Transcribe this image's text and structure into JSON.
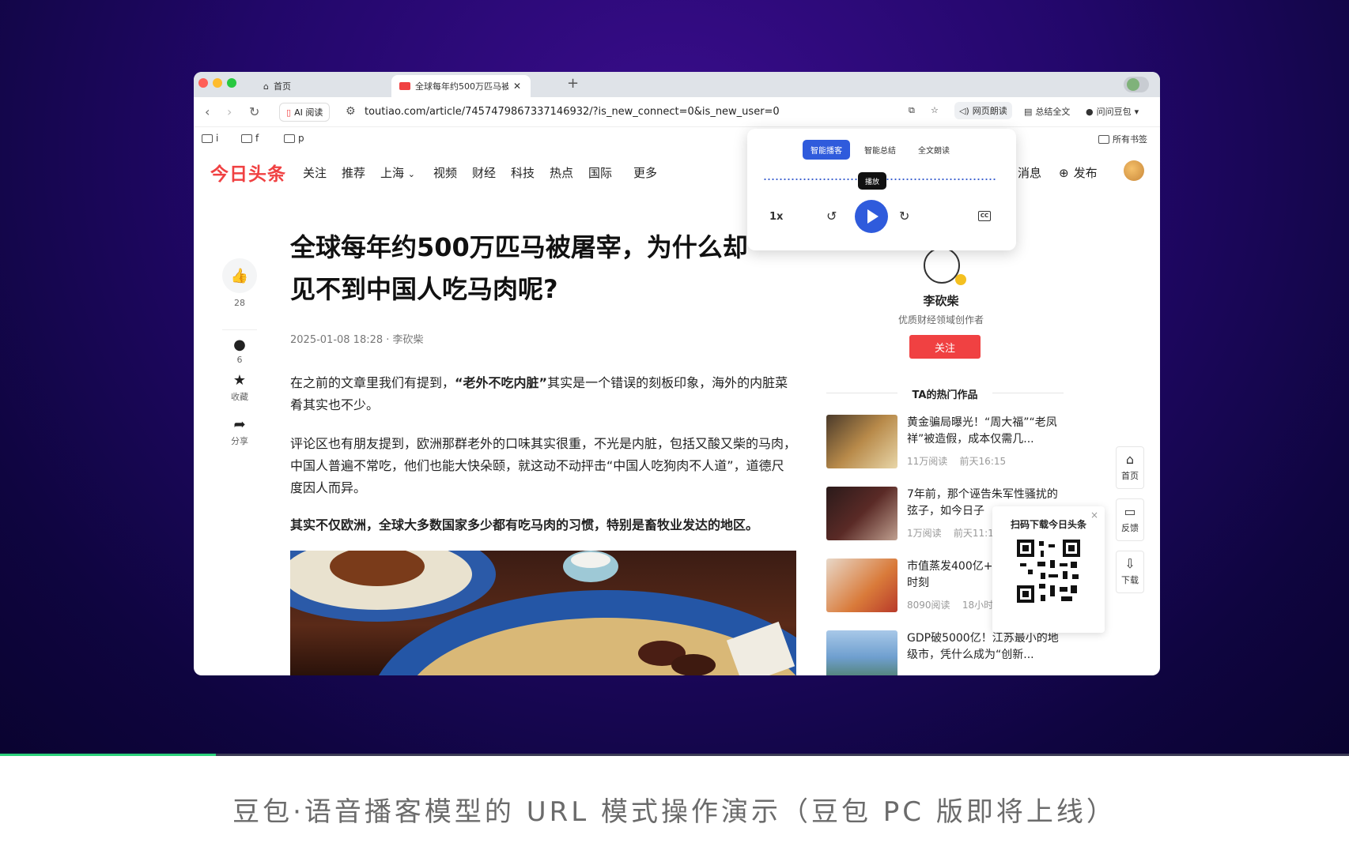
{
  "caption": "豆包·语音播客模型的 URL 模式操作演示（豆包 PC 版即将上线）",
  "video_progress": 0.16,
  "colors": {
    "brand_red": "#f04142",
    "accent_blue": "#2f5bdc",
    "bg_purple": "#22076a"
  },
  "browser": {
    "tabs": [
      {
        "label": "首页",
        "icon": "home-icon"
      },
      {
        "label": "全球每年约500万匹马被",
        "icon": "toutiao-favicon"
      }
    ],
    "new_tab": "+",
    "ai_read": "AI 阅读",
    "url": "toutiao.com/article/7457479867337146932/?is_new_connect=0&is_new_user=0",
    "tools": {
      "read_aloud": "网页朗读",
      "summarize": "总结全文",
      "ask": "问问豆包"
    },
    "bookmarks": [
      "i",
      "f",
      "p"
    ],
    "all_bookmarks": "所有书签"
  },
  "site": {
    "logo": "今日头条",
    "nav": [
      "关注",
      "推荐",
      "上海",
      "视频",
      "财经",
      "科技",
      "热点",
      "国际",
      "更多"
    ],
    "messages": "消息",
    "publish": "发布"
  },
  "rail": {
    "likes": "28",
    "comments": "6",
    "favorite": "收藏",
    "share": "分享"
  },
  "article": {
    "title": "全球每年约500万匹马被屠宰，为什么却见不到中国人吃马肉呢?",
    "meta": "2025-01-08 18:28 · 李砍柴",
    "p1_pre": "在之前的文章里我们有提到，",
    "p1_bold": "“老外不吃内脏”",
    "p1_post": "其实是一个错误的刻板印象，海外的内脏菜肴其实也不少。",
    "p2": "评论区也有朋友提到，欧洲那群老外的口味其实很重，不光是内脏，包括又酸又柴的马肉，中国人普遍不常吃，他们也能大快朵颐，就这动不动抨击“中国人吃狗肉不人道”，道德尺度因人而异。",
    "p3": "其实不仅欧洲，全球大多数国家多少都有吃马肉的习惯，特别是畜牧业发达的地区。"
  },
  "author": {
    "name": "李砍柴",
    "desc": "优质财经领域创作者",
    "follow": "关注",
    "hot_title": "TA的热门作品"
  },
  "hot_items": [
    {
      "title": "黄金骗局曝光！“周大福”“老凤祥”被造假，成本仅需几...",
      "reads": "11万阅读",
      "time": "前天16:15",
      "thumb": "#b88a4a"
    },
    {
      "title": "7年前，那个诬告朱军性骚扰的弦子，如今日子",
      "reads": "1万阅读",
      "time": "前天11:1",
      "thumb": "#5a2a26"
    },
    {
      "title": "市值蒸发400亿+权：小米至暗时刻",
      "reads": "8090阅读",
      "time": "18小时",
      "thumb": "#d97a3a"
    },
    {
      "title": "GDP破5000亿！江苏最小的地级市，凭什么成为“创新...",
      "reads": "",
      "time": "",
      "thumb": "#6f9fcf"
    }
  ],
  "side_tools": [
    "首页",
    "反馈",
    "下载"
  ],
  "qr": {
    "title": "扫码下载今日头条",
    "close": "×"
  },
  "podcast": {
    "tabs": [
      "智能播客",
      "智能总结",
      "全文朗读"
    ],
    "active_tab": 0,
    "speed": "1x",
    "tooltip": "播放",
    "cc": "CC"
  }
}
